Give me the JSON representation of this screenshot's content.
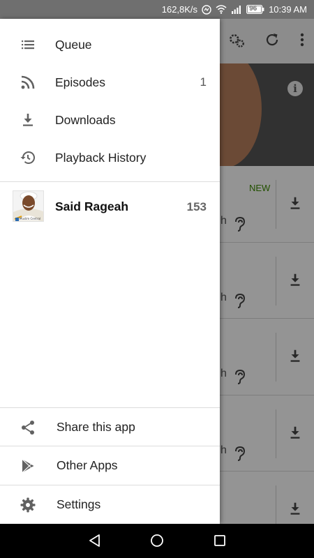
{
  "status_bar": {
    "speed": "162,8K/s",
    "battery": "96",
    "time": "10:39 AM"
  },
  "drawer": {
    "nav_items": [
      {
        "label": "Queue",
        "icon": "queue-list-icon",
        "count": ""
      },
      {
        "label": "Episodes",
        "icon": "rss-feed-icon",
        "count": "1"
      },
      {
        "label": "Downloads",
        "icon": "download-icon",
        "count": ""
      },
      {
        "label": "Playback History",
        "icon": "history-icon",
        "count": ""
      }
    ],
    "podcast": {
      "name": "Said Rageah",
      "count": "153",
      "thumb_caption": "Muslim Central"
    },
    "footer_items": [
      {
        "label": "Share this app",
        "icon": "share-icon"
      },
      {
        "label": "Other Apps",
        "icon": "play-store-icon"
      },
      {
        "label": "Settings",
        "icon": "settings-gear-icon"
      }
    ]
  },
  "background": {
    "new_badge": "NEW",
    "row_fragment": "h",
    "info_icon": "i",
    "accent_new": "#3c8a00"
  },
  "colors": {
    "status_bar": "#6f6f6f",
    "drawer_bg": "#ffffff",
    "icon_gray": "#616161"
  }
}
